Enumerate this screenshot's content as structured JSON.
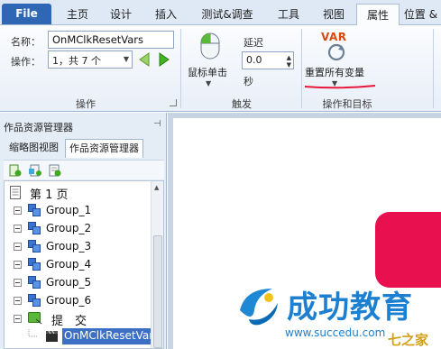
{
  "tabs": {
    "file": "File",
    "items": [
      "主页",
      "设计",
      "插入",
      "测试&调查",
      "工具",
      "视图",
      "属性",
      "位置 &"
    ]
  },
  "ribbon": {
    "name_label": "名称：",
    "name_value": "OnMClkResetVars",
    "operation_label": "操作：",
    "operation_value": "1，共 7 个",
    "group_operation": "操作",
    "trigger_button": "鼠标单击",
    "delay_label": "延迟",
    "delay_value": "0.0",
    "seconds_label": "秒",
    "group_trigger": "触发",
    "action_button": "重置所有变量",
    "var_icon_text": "VAR",
    "group_action": "操作和目标"
  },
  "panel": {
    "title": "作品资源管理器",
    "pin": "ᵖ",
    "tab_thumbnail": "缩略图视图",
    "tab_explorer": "作品资源管理器",
    "tree": [
      {
        "label": "第 1 页",
        "type": "page"
      },
      {
        "label": "Group_1",
        "type": "group"
      },
      {
        "label": "Group_2",
        "type": "group"
      },
      {
        "label": "Group_3",
        "type": "group"
      },
      {
        "label": "Group_4",
        "type": "group"
      },
      {
        "label": "Group_5",
        "type": "group"
      },
      {
        "label": "Group_6",
        "type": "group"
      },
      {
        "label": "提　交",
        "type": "submit"
      },
      {
        "label": "OnMClkResetVars",
        "type": "action"
      }
    ]
  },
  "watermark": {
    "cn": "成功教育",
    "url": "www.succedu.com",
    "brand": "七之家"
  },
  "colors": {
    "file_tab": "#2f67b5",
    "accent_red": "#e8104e",
    "selection": "#3d6fc4"
  }
}
